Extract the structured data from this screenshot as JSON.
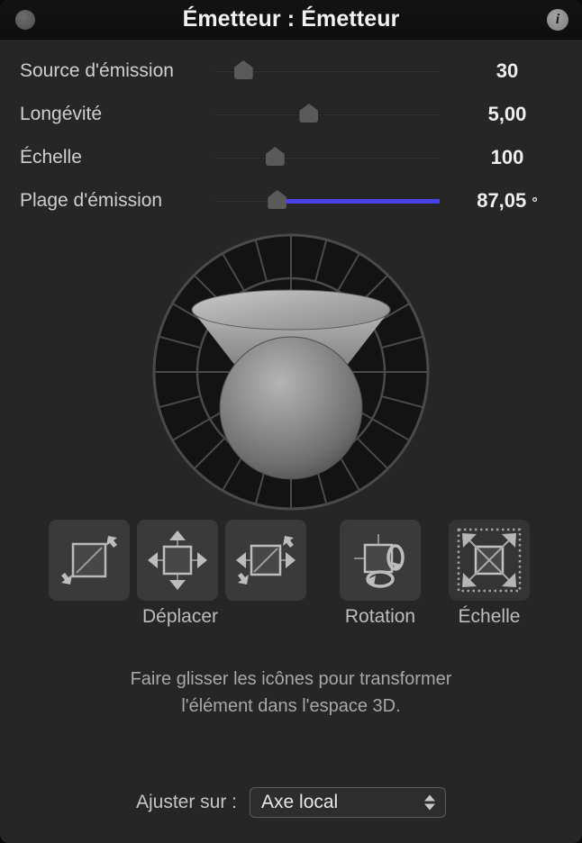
{
  "window": {
    "title": "Émetteur : Émetteur",
    "close_icon": "close-circle-icon",
    "info_icon": "info-icon",
    "info_glyph": "i"
  },
  "parameters": [
    {
      "label": "Source d'émission",
      "value": "30",
      "unit": "",
      "thumb_pct": 13,
      "fill": false
    },
    {
      "label": "Longévité",
      "value": "5,00",
      "unit": "",
      "thumb_pct": 42,
      "fill": false
    },
    {
      "label": "Échelle",
      "value": "100",
      "unit": "",
      "thumb_pct": 27,
      "fill": false
    },
    {
      "label": "Plage d'émission",
      "value": "87,05",
      "unit": "°",
      "thumb_pct": 28,
      "fill": true
    }
  ],
  "preview": {
    "name": "emission-range-3d-preview",
    "outer_segments": 24,
    "inner_segments": 12,
    "ring_color": "#4a4a4a",
    "sector_color": "#131313"
  },
  "transforms": {
    "groups": [
      {
        "label": "Déplacer",
        "buttons": [
          "move-z-icon",
          "move-xy-icon",
          "move-xyz-icon"
        ],
        "selected": false
      },
      {
        "label": "Rotation",
        "buttons": [
          "rotate-icon"
        ],
        "selected": false
      },
      {
        "label": "Échelle",
        "buttons": [
          "scale-icon"
        ],
        "selected": true
      }
    ]
  },
  "hint": {
    "line1": "Faire glisser les icônes pour transformer",
    "line2": "l'élément dans l'espace 3D."
  },
  "adjust": {
    "label": "Ajuster sur :",
    "value": "Axe local",
    "options": [
      "Axe local"
    ],
    "chevron_icon": "chevron-up-down-icon"
  },
  "colors": {
    "accent": "#4a42e8",
    "panel_bg": "#262626",
    "titlebar_bg": "#111111"
  }
}
